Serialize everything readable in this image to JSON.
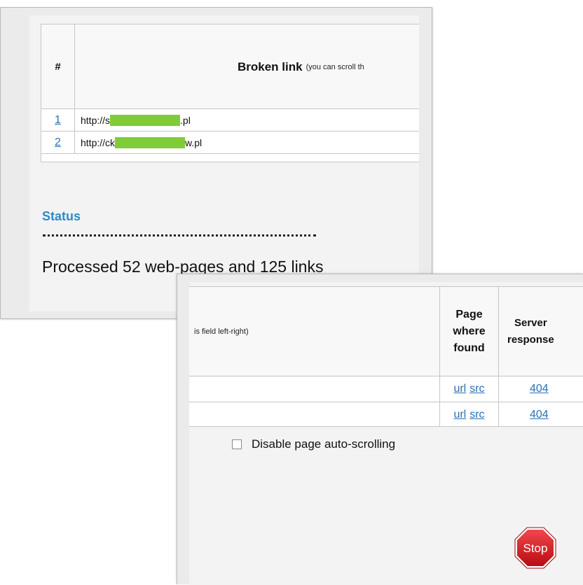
{
  "links_table": {
    "header_hash": "#",
    "header_broken_link": "Broken link",
    "header_hint_left": "(you can scroll th",
    "rows": [
      {
        "num": "1",
        "url_start": "http://s",
        "url_end": ".pl"
      },
      {
        "num": "2",
        "url_start": "http://ck",
        "url_end": "w.pl"
      }
    ]
  },
  "status": {
    "title": "Status",
    "processed_text": "Processed 52 web-pages and 125 links"
  },
  "results_table": {
    "header_hint_right": "is field left-right)",
    "header_page_found_1": "Page",
    "header_page_found_2": "where",
    "header_page_found_3": "found",
    "header_server_1": "Server",
    "header_server_2": "response",
    "rows": [
      {
        "url_link": "url",
        "src_link": "src",
        "response": "404"
      },
      {
        "url_link": "url",
        "src_link": "src",
        "response": "404"
      }
    ]
  },
  "options": {
    "disable_autoscroll_label": "Disable page auto-scrolling",
    "disable_autoscroll_checked": false
  },
  "controls": {
    "stop_label": "Stop"
  },
  "colors": {
    "accent_blue": "#2a8cc7",
    "redaction_green": "#7fcc38",
    "stop_red": "#d9141b"
  }
}
